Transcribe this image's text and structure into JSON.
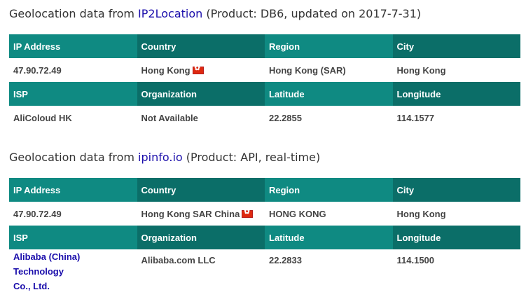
{
  "sections": [
    {
      "heading_prefix": "Geolocation data from ",
      "source": "IP2Location",
      "heading_suffix": " (Product: DB6, updated on 2017-7-31)",
      "headers1": [
        "IP Address",
        "Country",
        "Region",
        "City"
      ],
      "row1": [
        "47.90.72.49",
        "Hong Kong",
        "Hong Kong (SAR)",
        "Hong Kong"
      ],
      "headers2": [
        "ISP",
        "Organization",
        "Latitude",
        "Longitude"
      ],
      "row2": [
        "AliColoud HK",
        "Not Available",
        "22.2855",
        "114.1577"
      ]
    },
    {
      "heading_prefix": "Geolocation data from ",
      "source": "ipinfo.io",
      "heading_suffix": " (Product: API, real-time)",
      "headers1": [
        "IP Address",
        "Country",
        "Region",
        "City"
      ],
      "row1": [
        "47.90.72.49",
        "Hong Kong SAR China",
        "HONG KONG",
        "Hong Kong"
      ],
      "headers2": [
        "ISP",
        "Organization",
        "Latitude",
        "Longitude"
      ],
      "isp_line1": "Alibaba (China) Technology",
      "isp_line2": "Co., Ltd.",
      "row2": [
        "",
        "Alibaba.com LLC",
        "22.2833",
        "114.1500"
      ]
    }
  ],
  "icons": {
    "flag": "hong-kong-flag-icon"
  },
  "colors": {
    "header_primary": "#0f8a82",
    "header_secondary": "#0b6e68",
    "link": "#1a0dab"
  }
}
